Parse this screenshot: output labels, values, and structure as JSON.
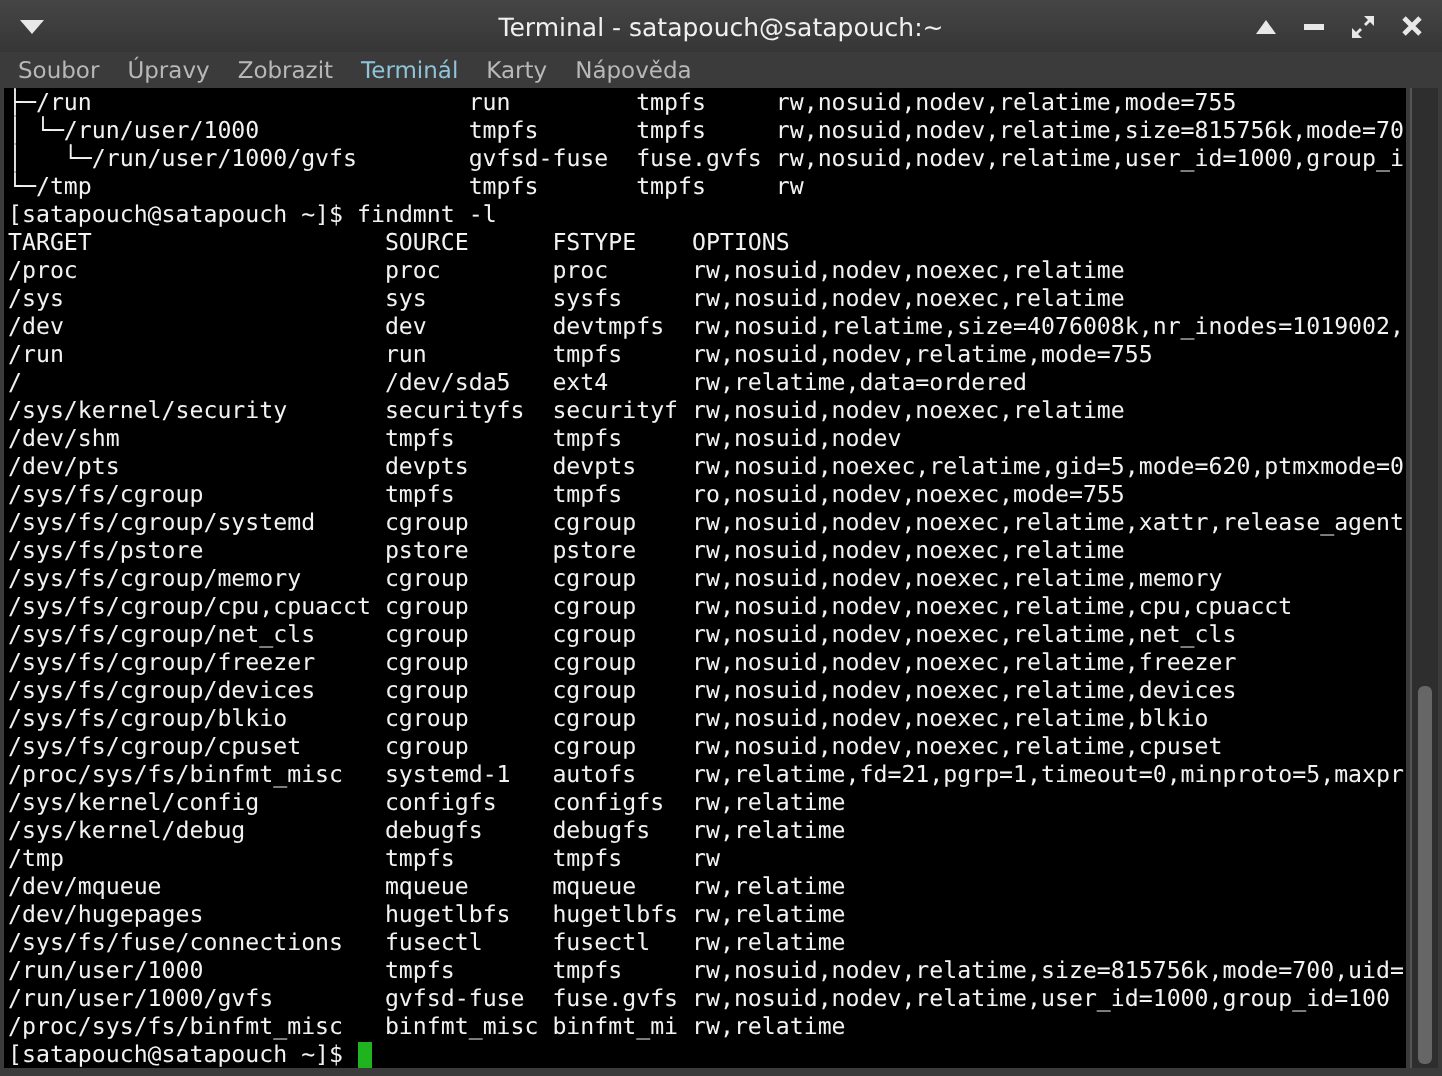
{
  "window": {
    "title": "Terminal - satapouch@satapouch:~"
  },
  "menu": [
    {
      "label": "Soubor",
      "selected": false
    },
    {
      "label": "Úpravy",
      "selected": false
    },
    {
      "label": "Zobrazit",
      "selected": false
    },
    {
      "label": "Terminál",
      "selected": true
    },
    {
      "label": "Karty",
      "selected": false
    },
    {
      "label": "Nápověda",
      "selected": false
    }
  ],
  "terminal": {
    "lines": [
      {
        "kind": "tree",
        "cells": [
          "├─/run",
          "run",
          "tmpfs",
          "rw,nosuid,nodev,relatime,mode=755"
        ]
      },
      {
        "kind": "tree",
        "cells": [
          "│ └─/run/user/1000",
          "tmpfs",
          "tmpfs",
          "rw,nosuid,nodev,relatime,size=815756k,mode=70"
        ]
      },
      {
        "kind": "tree",
        "cells": [
          "│   └─/run/user/1000/gvfs",
          "gvfsd-fuse",
          "fuse.gvfs",
          "rw,nosuid,nodev,relatime,user_id=1000,group_i"
        ]
      },
      {
        "kind": "tree",
        "cells": [
          "└─/tmp",
          "tmpfs",
          "tmpfs",
          "rw"
        ]
      },
      {
        "kind": "prompt",
        "text": "[satapouch@satapouch ~]$ findmnt -l",
        "cursor": false
      },
      {
        "kind": "table",
        "cells": [
          "TARGET",
          "SOURCE",
          "FSTYPE",
          "OPTIONS"
        ]
      },
      {
        "kind": "table",
        "cells": [
          "/proc",
          "proc",
          "proc",
          "rw,nosuid,nodev,noexec,relatime"
        ]
      },
      {
        "kind": "table",
        "cells": [
          "/sys",
          "sys",
          "sysfs",
          "rw,nosuid,nodev,noexec,relatime"
        ]
      },
      {
        "kind": "table",
        "cells": [
          "/dev",
          "dev",
          "devtmpfs",
          "rw,nosuid,relatime,size=4076008k,nr_inodes=1019002,"
        ]
      },
      {
        "kind": "table",
        "cells": [
          "/run",
          "run",
          "tmpfs",
          "rw,nosuid,nodev,relatime,mode=755"
        ]
      },
      {
        "kind": "table",
        "cells": [
          "/",
          "/dev/sda5",
          "ext4",
          "rw,relatime,data=ordered"
        ]
      },
      {
        "kind": "table",
        "cells": [
          "/sys/kernel/security",
          "securityfs",
          "securityf",
          "rw,nosuid,nodev,noexec,relatime"
        ]
      },
      {
        "kind": "table",
        "cells": [
          "/dev/shm",
          "tmpfs",
          "tmpfs",
          "rw,nosuid,nodev"
        ]
      },
      {
        "kind": "table",
        "cells": [
          "/dev/pts",
          "devpts",
          "devpts",
          "rw,nosuid,noexec,relatime,gid=5,mode=620,ptmxmode=0"
        ]
      },
      {
        "kind": "table",
        "cells": [
          "/sys/fs/cgroup",
          "tmpfs",
          "tmpfs",
          "ro,nosuid,nodev,noexec,mode=755"
        ]
      },
      {
        "kind": "table",
        "cells": [
          "/sys/fs/cgroup/systemd",
          "cgroup",
          "cgroup",
          "rw,nosuid,nodev,noexec,relatime,xattr,release_agent"
        ]
      },
      {
        "kind": "table",
        "cells": [
          "/sys/fs/pstore",
          "pstore",
          "pstore",
          "rw,nosuid,nodev,noexec,relatime"
        ]
      },
      {
        "kind": "table",
        "cells": [
          "/sys/fs/cgroup/memory",
          "cgroup",
          "cgroup",
          "rw,nosuid,nodev,noexec,relatime,memory"
        ]
      },
      {
        "kind": "table",
        "cells": [
          "/sys/fs/cgroup/cpu,cpuacct",
          "cgroup",
          "cgroup",
          "rw,nosuid,nodev,noexec,relatime,cpu,cpuacct"
        ]
      },
      {
        "kind": "table",
        "cells": [
          "/sys/fs/cgroup/net_cls",
          "cgroup",
          "cgroup",
          "rw,nosuid,nodev,noexec,relatime,net_cls"
        ]
      },
      {
        "kind": "table",
        "cells": [
          "/sys/fs/cgroup/freezer",
          "cgroup",
          "cgroup",
          "rw,nosuid,nodev,noexec,relatime,freezer"
        ]
      },
      {
        "kind": "table",
        "cells": [
          "/sys/fs/cgroup/devices",
          "cgroup",
          "cgroup",
          "rw,nosuid,nodev,noexec,relatime,devices"
        ]
      },
      {
        "kind": "table",
        "cells": [
          "/sys/fs/cgroup/blkio",
          "cgroup",
          "cgroup",
          "rw,nosuid,nodev,noexec,relatime,blkio"
        ]
      },
      {
        "kind": "table",
        "cells": [
          "/sys/fs/cgroup/cpuset",
          "cgroup",
          "cgroup",
          "rw,nosuid,nodev,noexec,relatime,cpuset"
        ]
      },
      {
        "kind": "table",
        "cells": [
          "/proc/sys/fs/binfmt_misc",
          "systemd-1",
          "autofs",
          "rw,relatime,fd=21,pgrp=1,timeout=0,minproto=5,maxpr"
        ]
      },
      {
        "kind": "table",
        "cells": [
          "/sys/kernel/config",
          "configfs",
          "configfs",
          "rw,relatime"
        ]
      },
      {
        "kind": "table",
        "cells": [
          "/sys/kernel/debug",
          "debugfs",
          "debugfs",
          "rw,relatime"
        ]
      },
      {
        "kind": "table",
        "cells": [
          "/tmp",
          "tmpfs",
          "tmpfs",
          "rw"
        ]
      },
      {
        "kind": "table",
        "cells": [
          "/dev/mqueue",
          "mqueue",
          "mqueue",
          "rw,relatime"
        ]
      },
      {
        "kind": "table",
        "cells": [
          "/dev/hugepages",
          "hugetlbfs",
          "hugetlbfs",
          "rw,relatime"
        ]
      },
      {
        "kind": "table",
        "cells": [
          "/sys/fs/fuse/connections",
          "fusectl",
          "fusectl",
          "rw,relatime"
        ]
      },
      {
        "kind": "table",
        "cells": [
          "/run/user/1000",
          "tmpfs",
          "tmpfs",
          "rw,nosuid,nodev,relatime,size=815756k,mode=700,uid="
        ]
      },
      {
        "kind": "table",
        "cells": [
          "/run/user/1000/gvfs",
          "gvfsd-fuse",
          "fuse.gvfs",
          "rw,nosuid,nodev,relatime,user_id=1000,group_id=100"
        ]
      },
      {
        "kind": "table",
        "cells": [
          "/proc/sys/fs/binfmt_misc",
          "binfmt_misc",
          "binfmt_mi",
          "rw,relatime"
        ]
      },
      {
        "kind": "prompt",
        "text": "[satapouch@satapouch ~]$",
        "cursor": true
      }
    ]
  }
}
